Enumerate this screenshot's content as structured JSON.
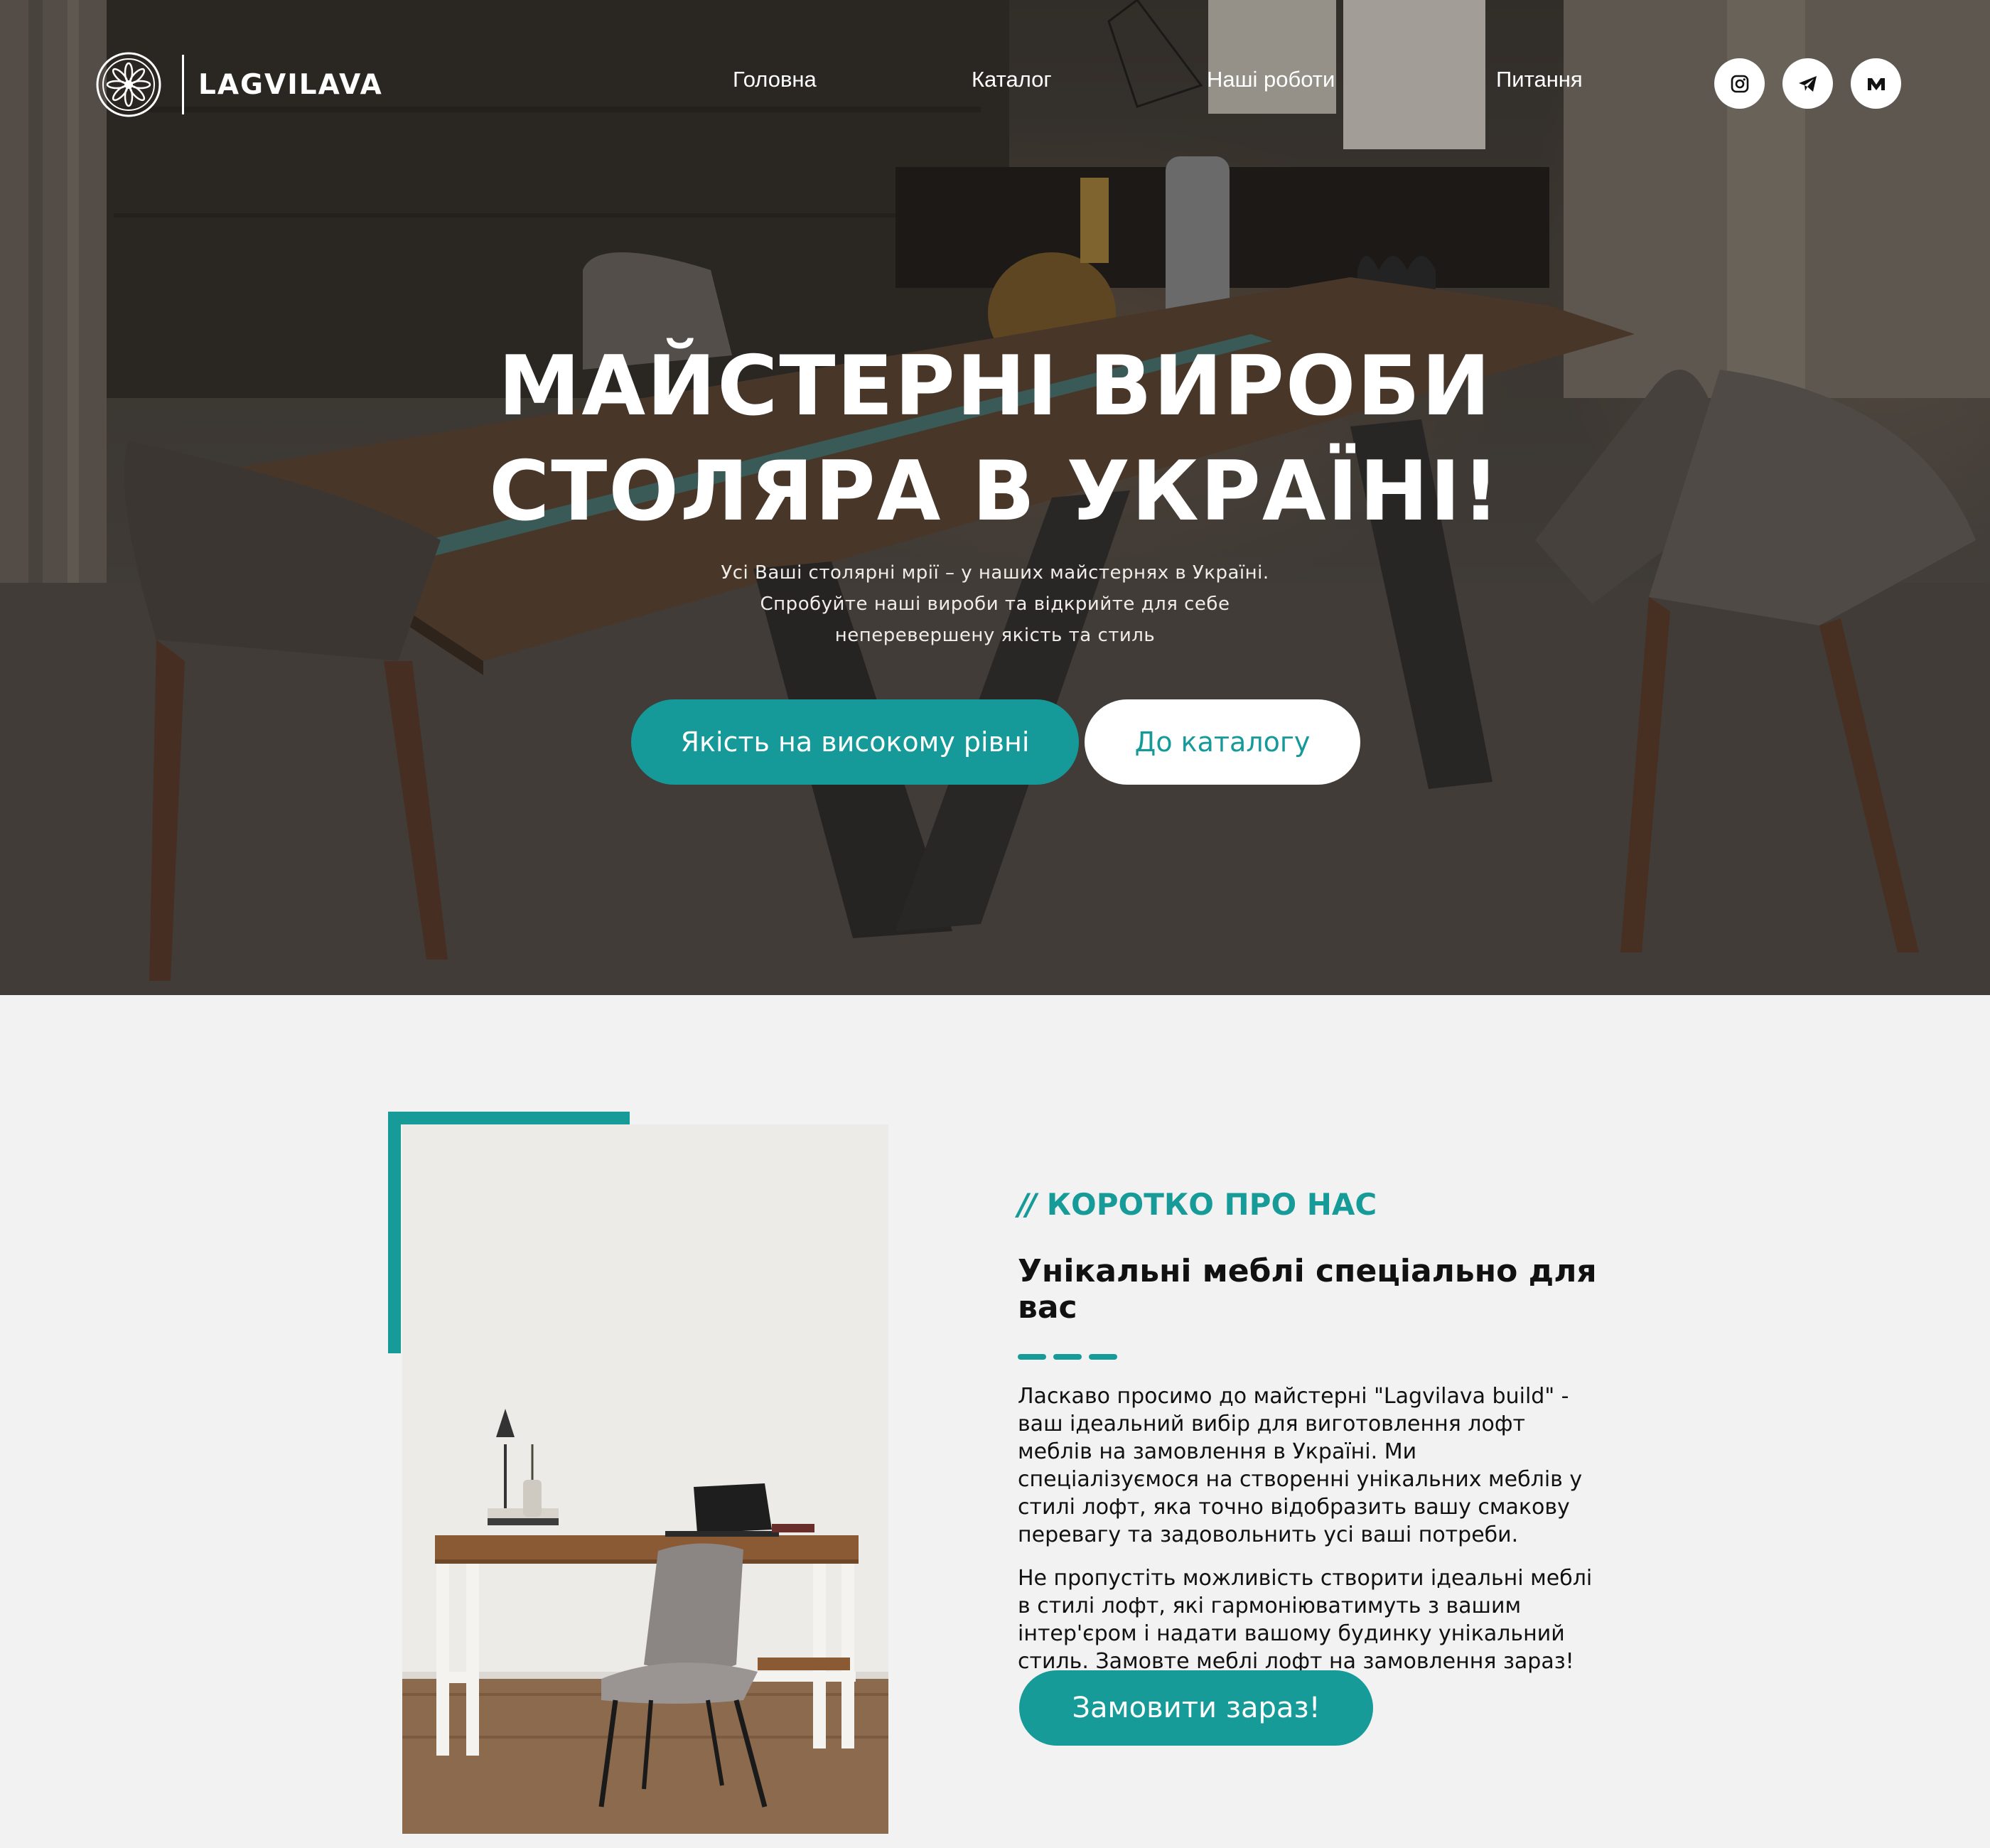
{
  "brand": {
    "name": "LAGVILAVA",
    "logo_icon": "flower-rosette-icon"
  },
  "nav": {
    "items": [
      {
        "label": "Головна"
      },
      {
        "label": "Каталог"
      },
      {
        "label": "Наші роботи"
      },
      {
        "label": "Питання"
      }
    ]
  },
  "social": [
    {
      "icon": "instagram-icon"
    },
    {
      "icon": "telegram-icon"
    },
    {
      "icon": "m-letter-icon"
    }
  ],
  "hero": {
    "title_line1": "МАЙСТЕРНІ ВИРОБИ",
    "title_line2": "СТОЛЯРА В УКРАЇНІ!",
    "subtitle_line1": "Усі Ваші столярні мрії – у наших майстернях в Україні.",
    "subtitle_line2": "Спробуйте наші вироби та відкрийте для себе",
    "subtitle_line3": "неперевершену якість та стиль",
    "cta_primary": "Якість на високому рівні",
    "cta_secondary": "До каталогу"
  },
  "about": {
    "kicker_slashes": "//",
    "kicker": "КОРОТКО ПРО НАС",
    "heading": "Унікальні меблі спеціально для вас",
    "paragraph1": "Ласкаво просимо до майстерні \"Lagvilava build\" - ваш ідеальний вибір для виготовлення лофт меблів на замовлення в Україні. Ми спеціалізуємося на створенні унікальних меблів у стилі лофт, яка точно відобразить вашу смакову перевагу та задовольнить усі ваші потреби.",
    "paragraph2": "Не пропустіть можливість створити ідеальні меблі в стилі лофт, які гармоніюватимуть з вашим інтер'єром і надати вашому будинку унікальний стиль. Замовте меблі лофт на замовлення зараз!",
    "order_button": "Замовити зараз!"
  },
  "colors": {
    "accent": "#169b99",
    "white": "#ffffff",
    "text": "#111111"
  }
}
